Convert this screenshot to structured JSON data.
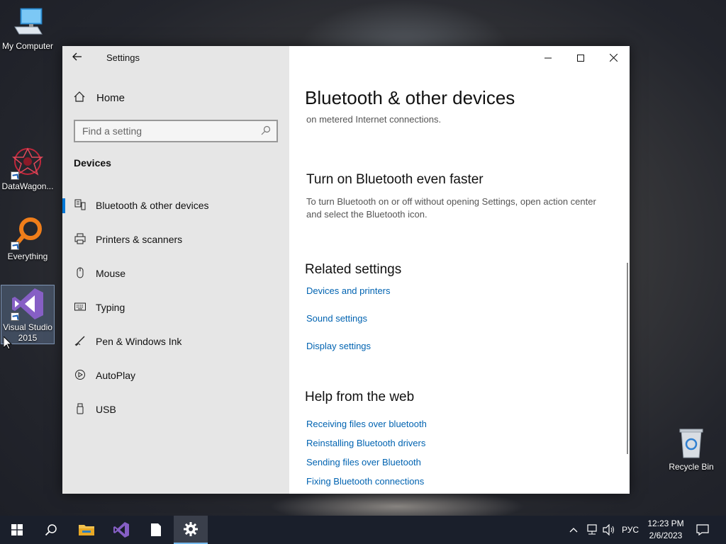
{
  "desktop": {
    "icons": [
      {
        "label": "My Computer"
      },
      {
        "label": "DataWagon..."
      },
      {
        "label": "Everything"
      },
      {
        "label": "Visual Studio 2015"
      },
      {
        "label": "Recycle Bin"
      }
    ]
  },
  "window": {
    "title": "Settings",
    "controls": {
      "minimize": "—",
      "maximize": "☐",
      "close": "✕"
    }
  },
  "nav": {
    "home_label": "Home",
    "search_placeholder": "Find a setting",
    "section": "Devices",
    "items": [
      {
        "label": "Bluetooth & other devices",
        "icon": "bluetooth-devices-icon"
      },
      {
        "label": "Printers & scanners",
        "icon": "printer-icon"
      },
      {
        "label": "Mouse",
        "icon": "mouse-icon"
      },
      {
        "label": "Typing",
        "icon": "keyboard-icon"
      },
      {
        "label": "Pen & Windows Ink",
        "icon": "pen-icon"
      },
      {
        "label": "AutoPlay",
        "icon": "autoplay-icon"
      },
      {
        "label": "USB",
        "icon": "usb-icon"
      }
    ]
  },
  "content": {
    "title": "Bluetooth & other devices",
    "metered_text": "on metered Internet connections.",
    "faster_heading": "Turn on Bluetooth even faster",
    "faster_text": "To turn Bluetooth on or off without opening Settings, open action center and select the Bluetooth icon.",
    "related_heading": "Related settings",
    "related_links": [
      "Devices and printers",
      "Sound settings",
      "Display settings"
    ],
    "help_heading": "Help from the web",
    "help_links": [
      "Receiving files over bluetooth",
      "Reinstalling Bluetooth drivers",
      "Sending files over Bluetooth",
      "Fixing Bluetooth connections"
    ]
  },
  "taskbar": {
    "language": "РУС",
    "time": "12:23 PM",
    "date": "2/6/2023"
  },
  "colors": {
    "accent": "#0078d7",
    "link": "#0063b1"
  }
}
